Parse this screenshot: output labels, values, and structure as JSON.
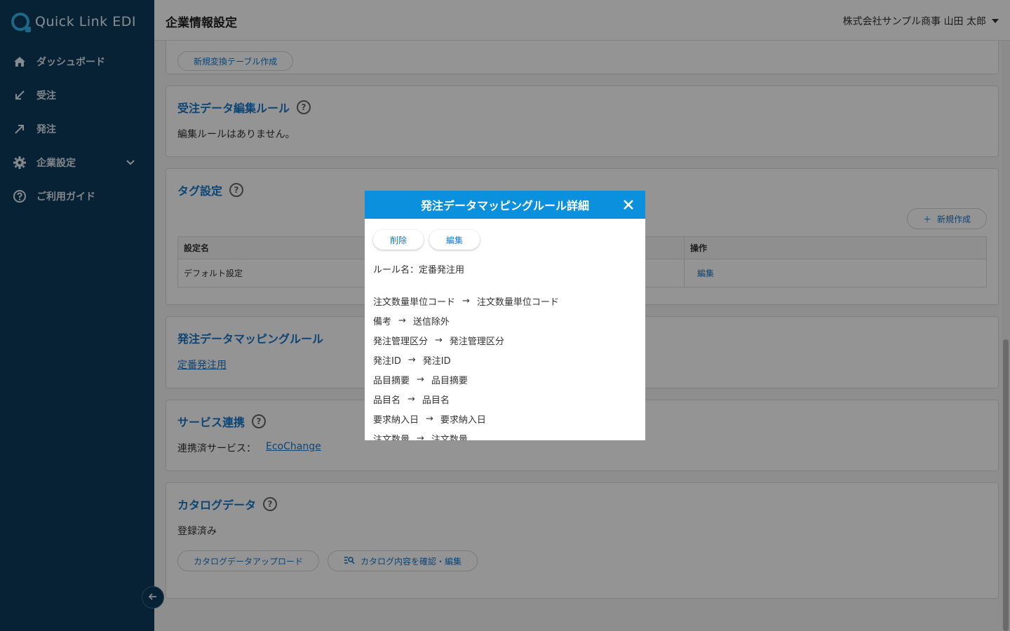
{
  "app": {
    "name": "Quick Link EDI"
  },
  "sidebar": {
    "items": [
      {
        "label": "ダッシュボード",
        "icon": "home-icon"
      },
      {
        "label": "受注",
        "icon": "arrow-down-left-icon"
      },
      {
        "label": "発注",
        "icon": "arrow-up-right-icon"
      },
      {
        "label": "企業設定",
        "icon": "gear-icon"
      },
      {
        "label": "ご利用ガイド",
        "icon": "help-circle-icon"
      }
    ]
  },
  "header": {
    "title": "企業情報設定",
    "user": "株式会社サンプル商事 山田 太郎"
  },
  "main": {
    "conversion": {
      "button": "新規変換テーブル作成"
    },
    "order_edit": {
      "title": "受注データ編集ルール",
      "empty": "編集ルールはありません。"
    },
    "tags": {
      "title": "タグ設定",
      "new_button": "新規作成",
      "columns": [
        "設定名",
        "操作"
      ],
      "rows": [
        {
          "name": "デフォルト設定",
          "action": "編集"
        }
      ]
    },
    "mapping": {
      "title": "発注データマッピングルール",
      "link": "定番発注用"
    },
    "service": {
      "title": "サービス連携",
      "label": "連携済サービス：",
      "link": "EcoChange"
    },
    "catalog": {
      "title": "カタログデータ",
      "status": "登録済み",
      "upload_button": "カタログデータアップロード",
      "check_button": "カタログ内容を確認・編集"
    }
  },
  "modal": {
    "title": "発注データマッピングルール詳細",
    "delete_label": "削除",
    "edit_label": "編集",
    "rule_name": "ルール名：定番発注用",
    "arrow": "→",
    "mappings": [
      {
        "from": "注文数量単位コード",
        "to": "注文数量単位コード"
      },
      {
        "from": "備考",
        "to": "送信除外"
      },
      {
        "from": "発注管理区分",
        "to": "発注管理区分"
      },
      {
        "from": "発注ID",
        "to": "発注ID"
      },
      {
        "from": "品目摘要",
        "to": "品目摘要"
      },
      {
        "from": "品目名",
        "to": "品目名"
      },
      {
        "from": "要求納入日",
        "to": "要求納入日"
      },
      {
        "from": "注文数量",
        "to": "注文数量"
      }
    ]
  },
  "colors": {
    "sidebar": "#0d3a5c",
    "accent": "#1677c9",
    "modal_header": "#0a90dd"
  }
}
